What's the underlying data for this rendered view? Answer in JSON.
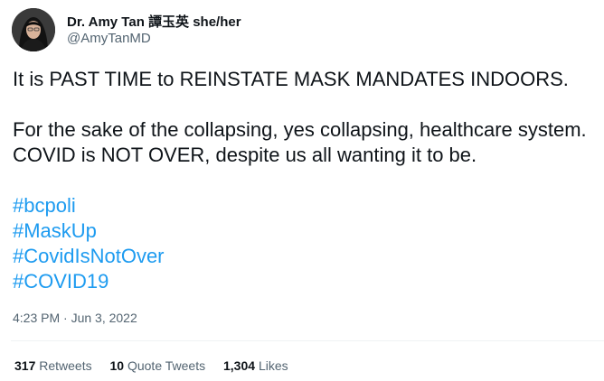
{
  "author": {
    "name": "Dr. Amy Tan 譚玉英 she/her",
    "handle": "@AmyTanMD"
  },
  "tweet": {
    "line1": "It is PAST TIME to REINSTATE MASK MANDATES INDOORS.",
    "line2": "For the sake of the collapsing, yes collapsing, healthcare system.",
    "line3": "COVID is NOT OVER, despite us all wanting it to be.",
    "hashtags": [
      "#bcpoli",
      "#MaskUp",
      "#CovidIsNotOver",
      "#COVID19"
    ],
    "timestamp": "4:23 PM · Jun 3, 2022"
  },
  "stats": {
    "retweets_count": "317",
    "retweets_label": "Retweets",
    "quotes_count": "10",
    "quotes_label": "Quote Tweets",
    "likes_count": "1,304",
    "likes_label": "Likes"
  },
  "colors": {
    "link": "#1d9bf0",
    "secondary_text": "#536471",
    "primary_text": "#0f1419"
  }
}
